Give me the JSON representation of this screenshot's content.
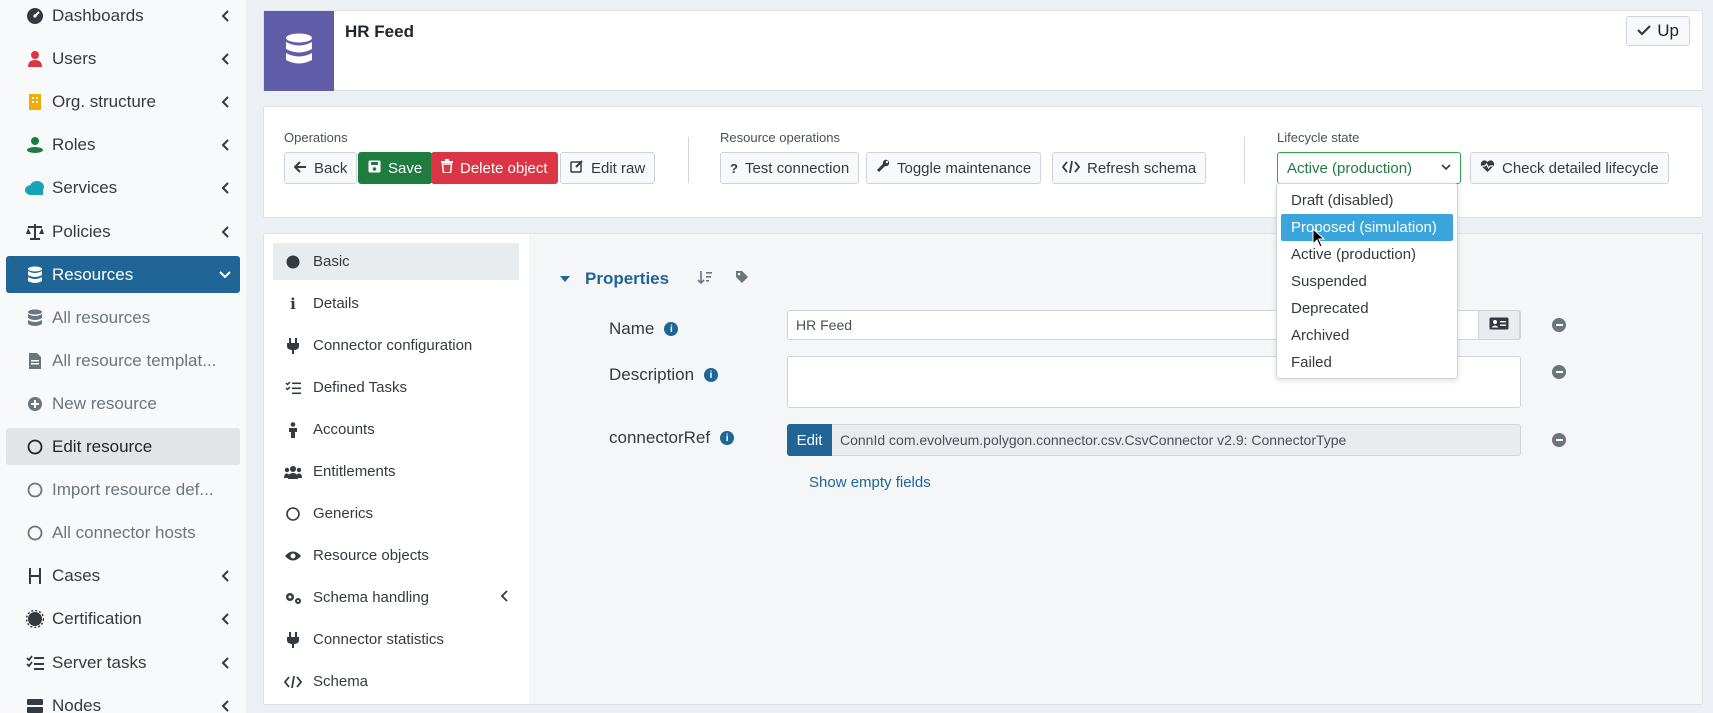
{
  "sidebar": {
    "items": [
      {
        "label": "Dashboards",
        "icon": "dashboard-icon"
      },
      {
        "label": "Users",
        "icon": "user-icon"
      },
      {
        "label": "Org. structure",
        "icon": "building-icon"
      },
      {
        "label": "Roles",
        "icon": "role-icon"
      },
      {
        "label": "Services",
        "icon": "cloud-icon"
      },
      {
        "label": "Policies",
        "icon": "scale-icon"
      },
      {
        "label": "Resources",
        "icon": "database-icon"
      },
      {
        "label": "All resources",
        "icon": "database-icon"
      },
      {
        "label": "All resource templat...",
        "icon": "file-icon"
      },
      {
        "label": "New resource",
        "icon": "plus-circle-icon"
      },
      {
        "label": "Edit resource",
        "icon": "circle-icon"
      },
      {
        "label": "Import resource def...",
        "icon": "circle-icon"
      },
      {
        "label": "All connector hosts",
        "icon": "circle-icon"
      },
      {
        "label": "Cases",
        "icon": "cases-icon"
      },
      {
        "label": "Certification",
        "icon": "certificate-icon"
      },
      {
        "label": "Server tasks",
        "icon": "tasks-icon"
      },
      {
        "label": "Nodes",
        "icon": "server-icon"
      }
    ]
  },
  "header": {
    "title": "HR Feed",
    "up_label": "Up"
  },
  "operations": {
    "label": "Operations",
    "back": "Back",
    "save": "Save",
    "delete": "Delete object",
    "edit_raw": "Edit raw"
  },
  "resource_operations": {
    "label": "Resource operations",
    "test": "Test connection",
    "toggle": "Toggle maintenance",
    "refresh": "Refresh schema"
  },
  "lifecycle": {
    "label": "Lifecycle state",
    "selected": "Active (production)",
    "check": "Check detailed lifecycle",
    "options": [
      "Draft (disabled)",
      "Proposed (simulation)",
      "Active (production)",
      "Suspended",
      "Deprecated",
      "Archived",
      "Failed"
    ]
  },
  "tabs": [
    "Basic",
    "Details",
    "Connector configuration",
    "Defined Tasks",
    "Accounts",
    "Entitlements",
    "Generics",
    "Resource objects",
    "Schema handling",
    "Connector statistics",
    "Schema"
  ],
  "properties": {
    "title": "Properties",
    "name_label": "Name",
    "name_value": "HR Feed",
    "description_label": "Description",
    "description_value": "",
    "connector_label": "connectorRef",
    "connector_edit": "Edit",
    "connector_value": "ConnId com.evolveum.polygon.connector.csv.CsvConnector v2.9: ConnectorType",
    "show_empty": "Show empty fields"
  },
  "colors": {
    "primary": "#1f6596",
    "success": "#1e7d3e",
    "danger": "#dc3545",
    "logo": "#605ca8",
    "highlight": "#39a5dc"
  }
}
